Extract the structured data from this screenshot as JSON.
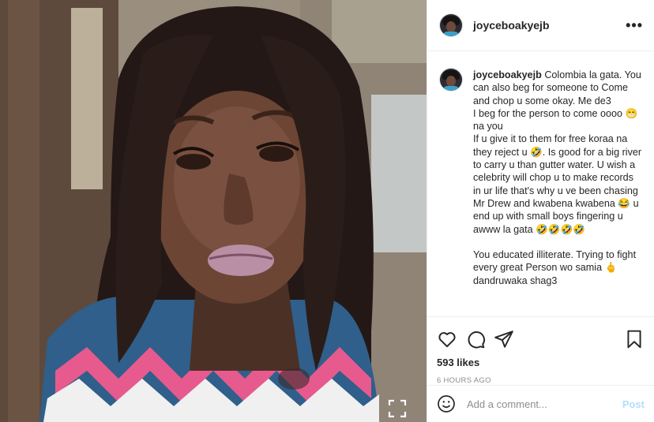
{
  "post": {
    "username": "joyceboakyejb",
    "more_icon": "more-horizontal-icon",
    "caption": {
      "username": "joyceboakyejb",
      "paragraphs": [
        "Colombia la gata. You can also beg for someone to Come and chop u some okay. Me de3",
        "I beg for the person to come oooo 😁 na you",
        "If u give it to them for free koraa na they reject u 🤣. Is good for a big river to carry u than gutter water. U wish a celebrity will chop u to make records in ur life that's why u ve been chasing Mr Drew and kwabena kwabena 😂 u end up with small boys fingering u awww la gata 🤣🤣🤣🤣",
        "",
        "You educated illiterate. Trying to fight every great Person wo samia 🖕dandruwaka shag3"
      ]
    },
    "actions": {
      "like_icon": "heart-icon",
      "comment_icon": "comment-icon",
      "share_icon": "paper-plane-icon",
      "save_icon": "bookmark-icon"
    },
    "likes": "593 likes",
    "timestamp": "6 HOURS AGO",
    "comment_box": {
      "placeholder": "Add a comment...",
      "post_label": "Post",
      "emoji_icon": "smiley-icon"
    },
    "media": {
      "expand_icon": "expand-icon"
    }
  }
}
